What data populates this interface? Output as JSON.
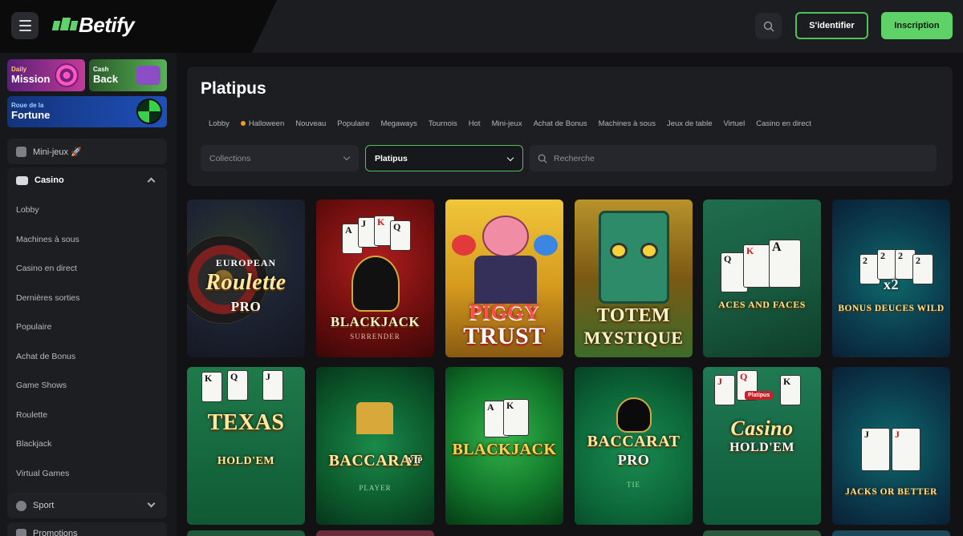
{
  "header": {
    "logo_text": "Betify",
    "login_label": "S'identifier",
    "signup_label": "Inscription",
    "accent_color": "#5ed267"
  },
  "promos": {
    "mission": {
      "small": "Daily",
      "big": "Mission"
    },
    "cashback": {
      "small": "Cash",
      "big": "Back"
    },
    "wheel": {
      "small": "Roue de la",
      "big": "Fortune"
    }
  },
  "sidebar": {
    "minigames_label": "Mini-jeux 🚀",
    "casino_label": "Casino",
    "casino_items": [
      "Lobby",
      "Machines à sous",
      "Casino en direct",
      "Dernières sorties",
      "Populaire",
      "Achat de Bonus",
      "Game Shows",
      "Roulette",
      "Blackjack",
      "Virtual Games"
    ],
    "sport_label": "Sport",
    "promotions_label": "Promotions"
  },
  "main": {
    "title": "Platipus",
    "filters": [
      "Lobby",
      "Halloween",
      "Nouveau",
      "Populaire",
      "Megaways",
      "Tournois",
      "Hot",
      "Mini-jeux",
      "Achat de Bonus",
      "Machines à sous",
      "Jeux de table",
      "Virtuel",
      "Casino en direct"
    ],
    "collections_label": "Collections",
    "provider_label": "Platipus",
    "search_placeholder": "Recherche"
  },
  "games": [
    {
      "line1": "EUROPEAN",
      "line2": "Roulette",
      "line3": "PRO"
    },
    {
      "line1": "BLACKJACK",
      "line2": "SURRENDER",
      "line3": ""
    },
    {
      "line1": "PIGGY",
      "line2": "TRUST",
      "line3": ""
    },
    {
      "line1": "TOTEM",
      "line2": "MYSTIQUE",
      "line3": ""
    },
    {
      "line1": "ACES AND FACES",
      "line2": "",
      "line3": ""
    },
    {
      "line1": "BONUS DEUCES WILD",
      "line2": "x2",
      "line3": ""
    },
    {
      "line1": "TEXAS",
      "line2": "HOLD'EM",
      "line3": ""
    },
    {
      "line1": "BACCARAT",
      "line2": "VIP",
      "line3": "PLAYER"
    },
    {
      "line1": "BLACKJACK",
      "line2": "",
      "line3": ""
    },
    {
      "line1": "BACCARAT",
      "line2": "PRO",
      "line3": "TIE"
    },
    {
      "line1": "Casino",
      "line2": "HOLD'EM",
      "line3": "Platipus"
    },
    {
      "line1": "JACKS OR BETTER",
      "line2": "",
      "line3": ""
    }
  ],
  "icons": [
    "menu-icon",
    "search-icon",
    "chevron-down-icon",
    "chevron-up-icon",
    "casino-icon",
    "sport-icon",
    "promotions-icon"
  ]
}
